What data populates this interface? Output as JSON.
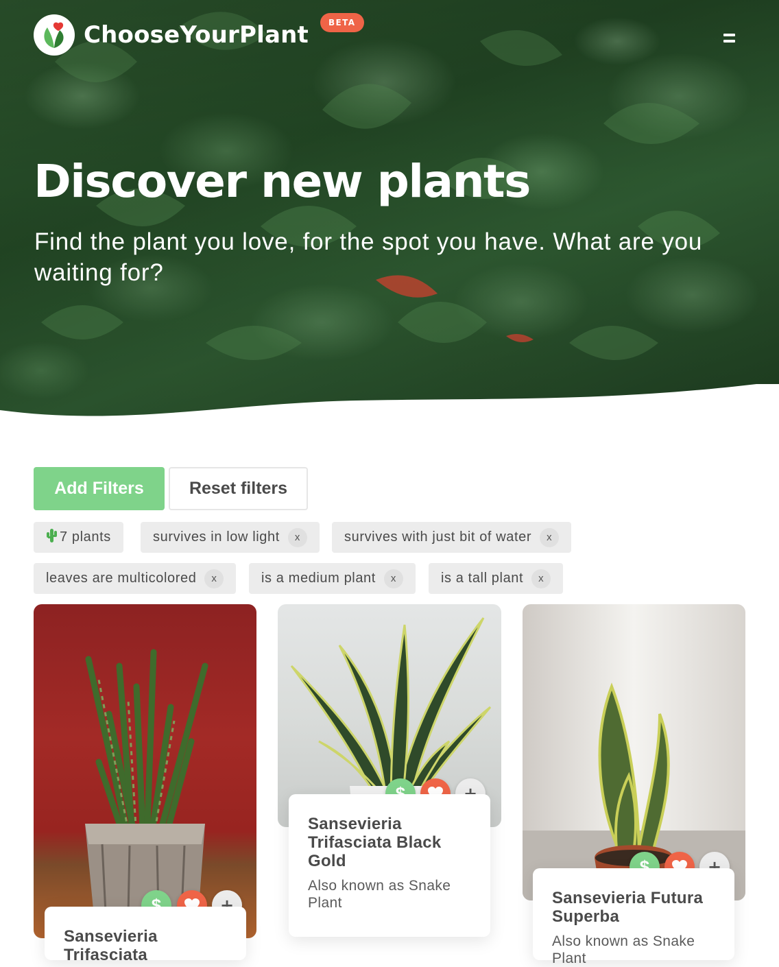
{
  "brand": {
    "name": "ChooseYourPlant",
    "badge": "BETA"
  },
  "hero": {
    "title": "Discover new plants",
    "subtitle": "Find the plant you love, for the spot you have. What are you waiting for?"
  },
  "filters": {
    "add_label": "Add Filters",
    "reset_label": "Reset filters",
    "count_label": "7 plants",
    "remove_label": "x",
    "active": [
      "survives in low light",
      "survives with just bit of water",
      "leaves are multicolored",
      "is a medium plant",
      "is a tall plant"
    ]
  },
  "cards": [
    {
      "title": "Sansevieria Trifasciata",
      "aka": ""
    },
    {
      "title": "Sansevieria Trifasciata Black Gold",
      "aka": "Also known as Snake Plant"
    },
    {
      "title": "Sansevieria Futura Superba",
      "aka": "Also known as Snake Plant"
    }
  ],
  "card_actions": {
    "price_symbol": "$",
    "add_symbol": "+"
  },
  "colors": {
    "accent_green": "#7fd38a",
    "accent_red": "#ef6447",
    "chip_bg": "#ececec",
    "text": "#4a4a4a"
  },
  "icons": [
    "logo-icon",
    "menu-icon",
    "cactus-icon",
    "heart-icon"
  ]
}
